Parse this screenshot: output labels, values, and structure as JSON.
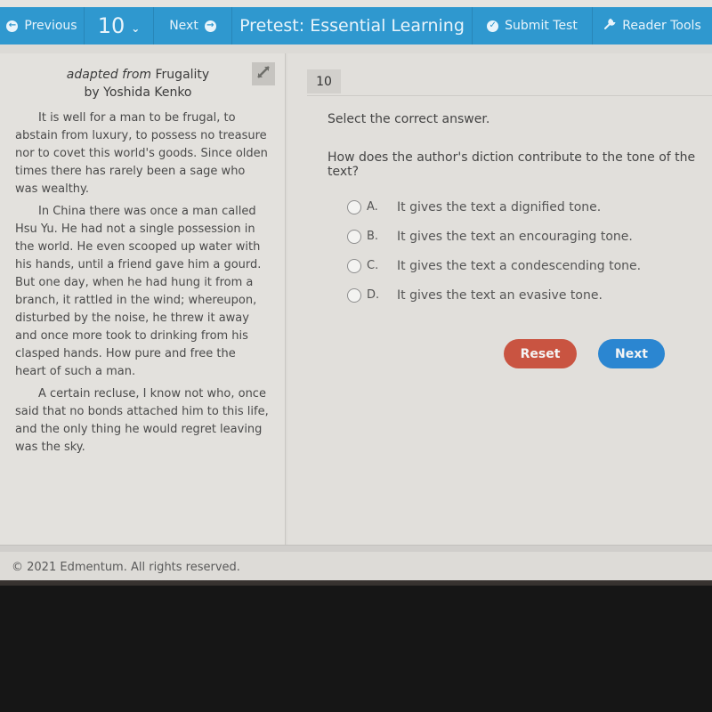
{
  "toolbar": {
    "previous_label": "Previous",
    "question_number": "10",
    "next_label": "Next",
    "title": "Pretest: Essential Learning",
    "submit_label": "Submit Test",
    "reader_tools_label": "Reader Tools",
    "color": "#2f98cf"
  },
  "passage": {
    "source_prefix": "adapted from",
    "source_title": "Frugality",
    "author": "by Yoshida Kenko",
    "paragraphs": [
      "It is well for a man to be frugal, to abstain from luxury, to possess no treasure nor to covet this world's goods. Since olden times there has rarely been a sage who was wealthy.",
      "In China there was once a man called Hsu Yu. He had not a single possession in the world. He even scooped up water with his hands, until a friend gave him a gourd. But one day, when he had hung it from a branch, it rattled in the wind; whereupon, disturbed by the noise, he threw it away and once more took to drinking from his clasped hands. How pure and free the heart of such a man.",
      "A certain recluse, I know not who, once said that no bonds attached him to this life, and the only thing he would regret leaving was the sky."
    ]
  },
  "question": {
    "number": "10",
    "instruction": "Select the correct answer.",
    "prompt": "How does the author's diction contribute to the tone of the text?",
    "options": [
      {
        "letter": "A.",
        "text": "It gives the text a dignified tone."
      },
      {
        "letter": "B.",
        "text": "It gives the text an encouraging tone."
      },
      {
        "letter": "C.",
        "text": "It gives the text a condescending tone."
      },
      {
        "letter": "D.",
        "text": "It gives the text an evasive tone."
      }
    ],
    "reset_label": "Reset",
    "next_label": "Next",
    "reset_color": "#c95441",
    "next_color": "#2b86d1"
  },
  "footer": {
    "copyright": "© 2021 Edmentum. All rights reserved."
  }
}
